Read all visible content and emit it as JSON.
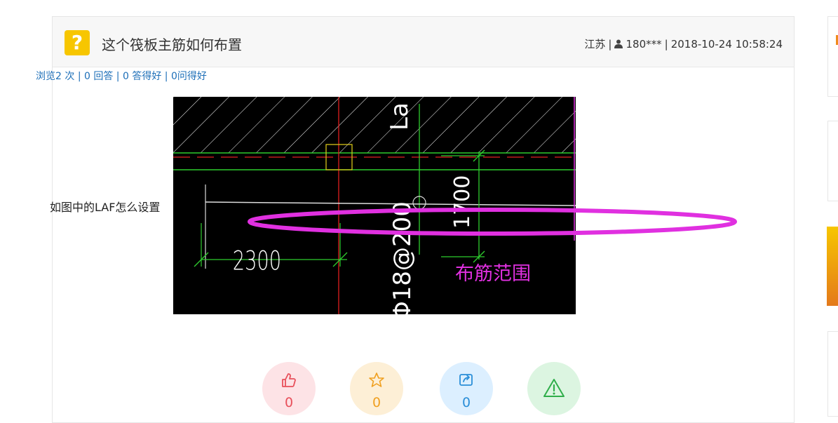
{
  "question": {
    "icon": "question-icon",
    "icon_glyph": "?",
    "title": "这个筏板主筋如何布置",
    "location": "江苏",
    "separator": "|",
    "user": "180***",
    "datetime": "2018-10-24 10:58:24"
  },
  "stats": {
    "views": "浏览2 次",
    "answers": "0 回答",
    "good_answers": "0 答得好",
    "good_question": "0问得好",
    "separator": "|"
  },
  "body_text": "如图中的LAF怎么设置",
  "image": {
    "labels": {
      "dim_left": "2300",
      "rebar": "Φ18@200",
      "dim_right": "1700",
      "top_label": "La",
      "annotation": "布筋范围"
    }
  },
  "actions": [
    {
      "name": "like",
      "icon": "thumbs-up-icon",
      "count": "0",
      "color": "#e8505b",
      "bg": "#fde3e6"
    },
    {
      "name": "favorite",
      "icon": "star-icon",
      "count": "0",
      "color": "#f0a020",
      "bg": "#fdefd6"
    },
    {
      "name": "share",
      "icon": "share-icon",
      "count": "0",
      "color": "#2a8ed8",
      "bg": "#dcefff"
    },
    {
      "name": "report",
      "icon": "warning-icon",
      "count": "",
      "color": "#2fae4a",
      "bg": "#dcf5e1"
    }
  ],
  "colors": {
    "accent_link": "#1d6fb8",
    "question_icon": "#f7c600",
    "cad_magenta": "#e030e0"
  }
}
